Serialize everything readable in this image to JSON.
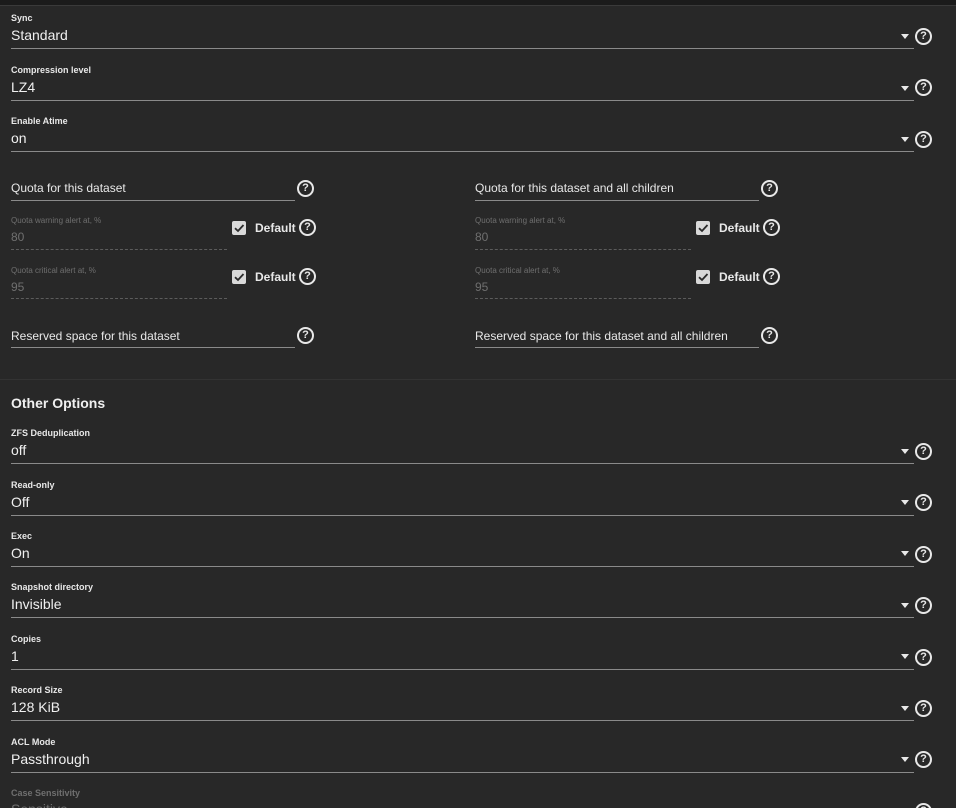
{
  "selects_top": [
    {
      "label": "Sync",
      "value": "Standard"
    },
    {
      "label": "Compression level",
      "value": "LZ4"
    },
    {
      "label": "Enable Atime",
      "value": "on"
    }
  ],
  "quota_left": {
    "title": "Quota for this dataset",
    "warning_label": "Quota warning alert at, %",
    "warning_value": "80",
    "critical_label": "Quota critical alert at, %",
    "critical_value": "95",
    "default_label": "Default",
    "reserved": "Reserved space for this dataset"
  },
  "quota_right": {
    "title": "Quota for this dataset and all children",
    "warning_label": "Quota warning alert at, %",
    "warning_value": "80",
    "critical_label": "Quota critical alert at, %",
    "critical_value": "95",
    "default_label": "Default",
    "reserved": "Reserved space for this dataset and all children"
  },
  "other_options": {
    "title": "Other Options",
    "selects": [
      {
        "label": "ZFS Deduplication",
        "value": "off"
      },
      {
        "label": "Read-only",
        "value": "Off"
      },
      {
        "label": "Exec",
        "value": "On"
      },
      {
        "label": "Snapshot directory",
        "value": "Invisible"
      },
      {
        "label": "Copies",
        "value": "1"
      },
      {
        "label": "Record Size",
        "value": "128 KiB"
      },
      {
        "label": "ACL Mode",
        "value": "Passthrough"
      }
    ],
    "partial_label": "Case Sensitivity",
    "partial_value": "Sensitive"
  },
  "icons": {
    "help": "?"
  }
}
